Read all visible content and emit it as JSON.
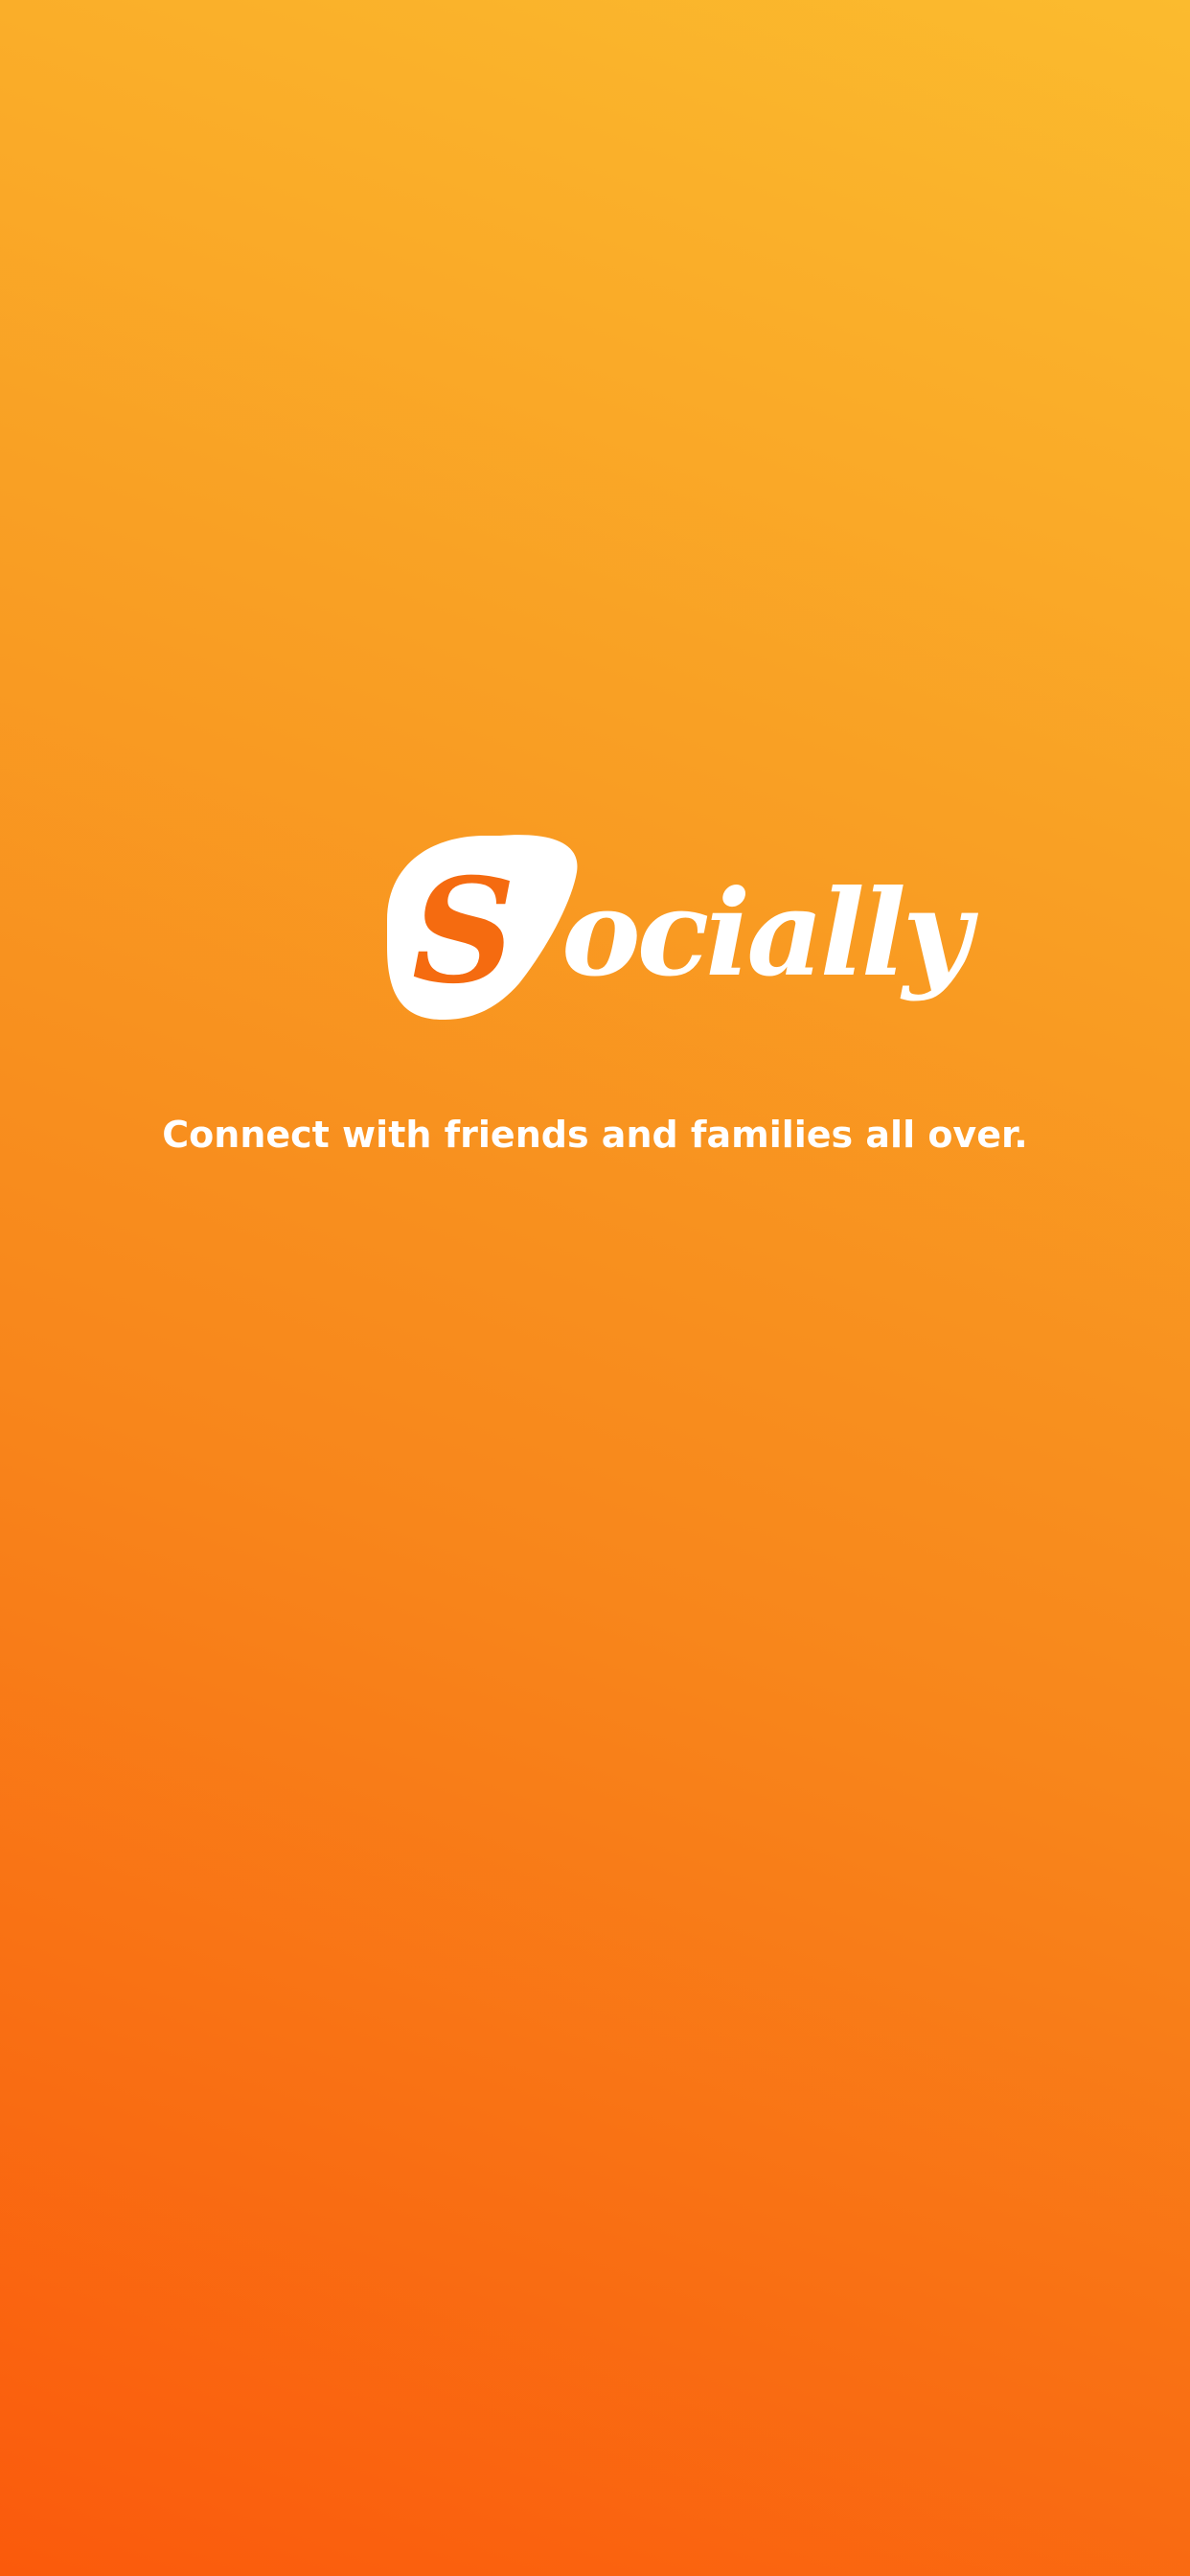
{
  "brand": {
    "initial": "S",
    "name_rest": "ocially",
    "logo_icon": "speech-bubble-logo-icon"
  },
  "tagline": "Connect with friends and families all over.",
  "colors": {
    "gradient_top": "#fbbb2e",
    "gradient_bottom": "#fa5a0c",
    "text": "#ffffff",
    "logo_letter": "#f56b10"
  }
}
